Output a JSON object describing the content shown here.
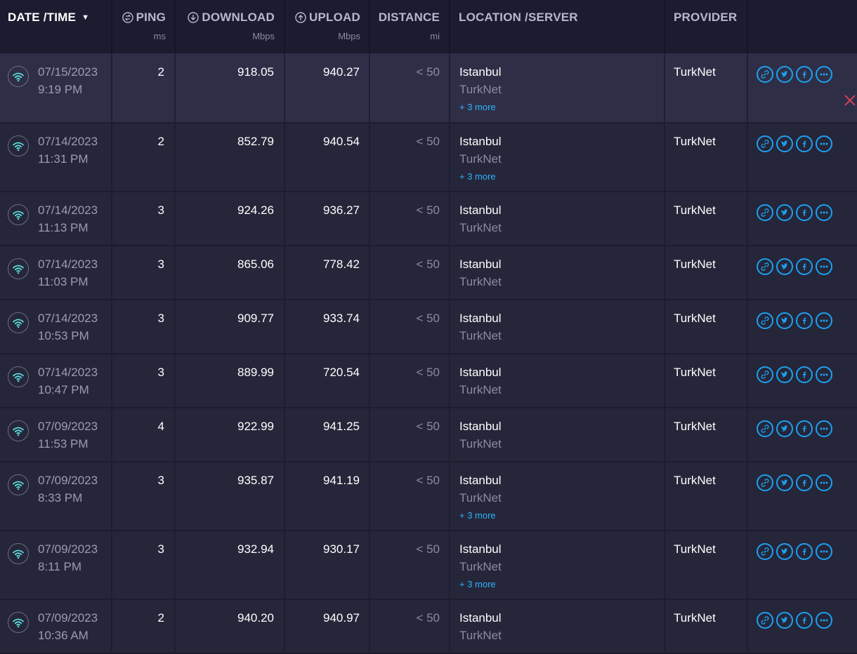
{
  "header": {
    "datetime": "DATE /TIME",
    "ping": "PING",
    "ping_unit": "ms",
    "download": "DOWNLOAD",
    "download_unit": "Mbps",
    "upload": "UPLOAD",
    "upload_unit": "Mbps",
    "distance": "DISTANCE",
    "distance_unit": "mi",
    "location": "LOCATION /SERVER",
    "provider": "PROVIDER"
  },
  "colors": {
    "accent": "#1da1f2",
    "more_link": "#2fb3ff",
    "wifi": "#5ee0e0",
    "close": "#e0405a"
  },
  "rows": [
    {
      "date": "07/15/2023",
      "time": "9:19 PM",
      "ping": "2",
      "download": "918.05",
      "upload": "940.27",
      "distance": "< 50",
      "location": "Istanbul",
      "server": "TurkNet",
      "more": "+ 3 more",
      "provider": "TurkNet"
    },
    {
      "date": "07/14/2023",
      "time": "11:31 PM",
      "ping": "2",
      "download": "852.79",
      "upload": "940.54",
      "distance": "< 50",
      "location": "Istanbul",
      "server": "TurkNet",
      "more": "+ 3 more",
      "provider": "TurkNet"
    },
    {
      "date": "07/14/2023",
      "time": "11:13 PM",
      "ping": "3",
      "download": "924.26",
      "upload": "936.27",
      "distance": "< 50",
      "location": "Istanbul",
      "server": "TurkNet",
      "more": "",
      "provider": "TurkNet"
    },
    {
      "date": "07/14/2023",
      "time": "11:03 PM",
      "ping": "3",
      "download": "865.06",
      "upload": "778.42",
      "distance": "< 50",
      "location": "Istanbul",
      "server": "TurkNet",
      "more": "",
      "provider": "TurkNet"
    },
    {
      "date": "07/14/2023",
      "time": "10:53 PM",
      "ping": "3",
      "download": "909.77",
      "upload": "933.74",
      "distance": "< 50",
      "location": "Istanbul",
      "server": "TurkNet",
      "more": "",
      "provider": "TurkNet"
    },
    {
      "date": "07/14/2023",
      "time": "10:47 PM",
      "ping": "3",
      "download": "889.99",
      "upload": "720.54",
      "distance": "< 50",
      "location": "Istanbul",
      "server": "TurkNet",
      "more": "",
      "provider": "TurkNet"
    },
    {
      "date": "07/09/2023",
      "time": "11:53 PM",
      "ping": "4",
      "download": "922.99",
      "upload": "941.25",
      "distance": "< 50",
      "location": "Istanbul",
      "server": "TurkNet",
      "more": "",
      "provider": "TurkNet"
    },
    {
      "date": "07/09/2023",
      "time": "8:33 PM",
      "ping": "3",
      "download": "935.87",
      "upload": "941.19",
      "distance": "< 50",
      "location": "Istanbul",
      "server": "TurkNet",
      "more": "+ 3 more",
      "provider": "TurkNet"
    },
    {
      "date": "07/09/2023",
      "time": "8:11 PM",
      "ping": "3",
      "download": "932.94",
      "upload": "930.17",
      "distance": "< 50",
      "location": "Istanbul",
      "server": "TurkNet",
      "more": "+ 3 more",
      "provider": "TurkNet"
    },
    {
      "date": "07/09/2023",
      "time": "10:36 AM",
      "ping": "2",
      "download": "940.20",
      "upload": "940.97",
      "distance": "< 50",
      "location": "Istanbul",
      "server": "TurkNet",
      "more": "",
      "provider": "TurkNet"
    }
  ]
}
